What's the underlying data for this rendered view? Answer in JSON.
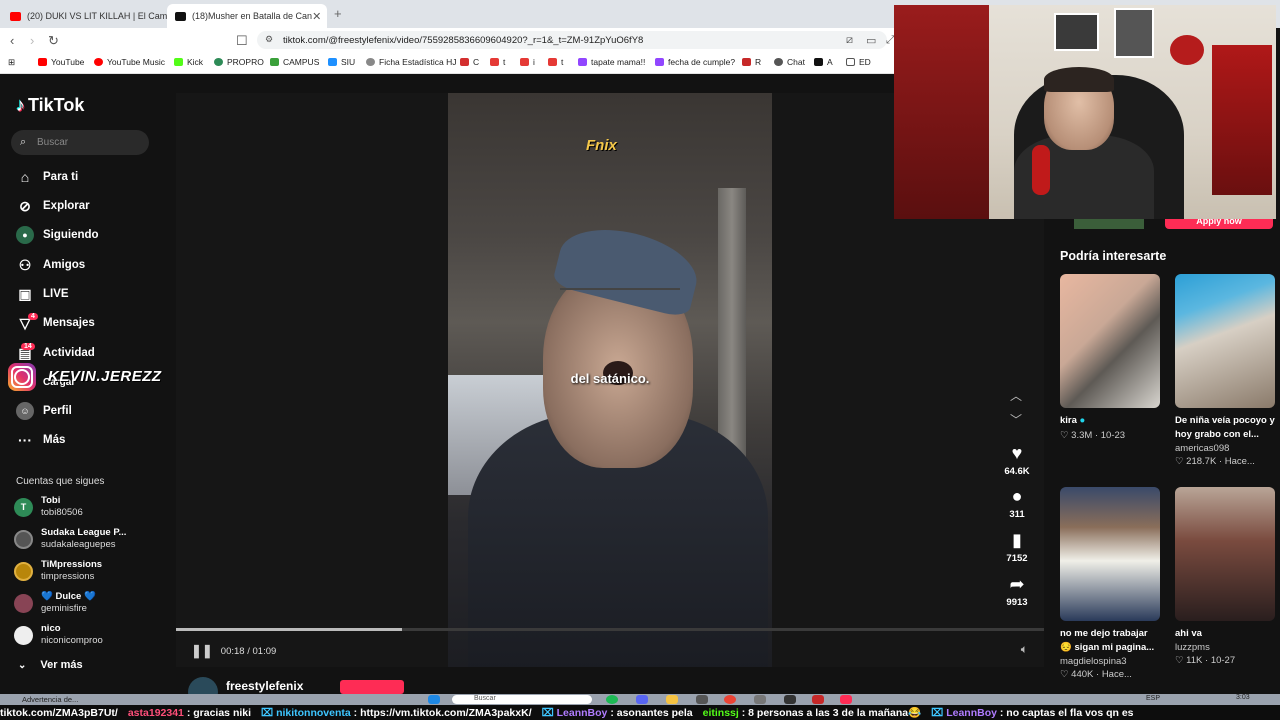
{
  "browser": {
    "tabs": [
      {
        "label": "(20) DUKI VS LIT KILLAH | El Campito",
        "icon": "youtube-icon",
        "color": "#ff0000"
      },
      {
        "label": "(18)Musher en Batalla de Can",
        "icon": "tiktok-icon",
        "color": "#111111"
      }
    ],
    "url": "tiktok.com/@freestylefenix/video/7559285836609604920?_r=1&_t=ZM-91ZpYuO6fY8",
    "bookmarks": [
      {
        "label": "YouTube",
        "color": "#ff0000"
      },
      {
        "label": "YouTube Music",
        "color": "#ff0000"
      },
      {
        "label": "Kick",
        "color": "#53fc18"
      },
      {
        "label": "PROPRO",
        "color": "#2e8b57"
      },
      {
        "label": "CAMPUS",
        "color": "#3aa03a"
      },
      {
        "label": "SIU",
        "color": "#1e90ff"
      },
      {
        "label": "Ficha Estadística HJ",
        "color": "#888888"
      },
      {
        "label": "C",
        "color": "#d32f2f"
      },
      {
        "label": "t",
        "color": "#e53935"
      },
      {
        "label": "i",
        "color": "#e53935"
      },
      {
        "label": "t",
        "color": "#e53935"
      },
      {
        "label": "tapate mama!!",
        "color": "#9146ff"
      },
      {
        "label": "fecha de cumple?",
        "color": "#9146ff"
      },
      {
        "label": "R",
        "color": "#c62828"
      },
      {
        "label": "Chat",
        "color": "#555555"
      },
      {
        "label": "A",
        "color": "#111111"
      },
      {
        "label": "ED",
        "color": "#555555"
      }
    ]
  },
  "sidebar": {
    "logo": "TikTok",
    "search_placeholder": "Buscar",
    "nav": [
      {
        "label": "Para ti",
        "icon": "home-icon"
      },
      {
        "label": "Explorar",
        "icon": "compass-icon"
      },
      {
        "label": "Siguiendo",
        "icon": "following-icon"
      },
      {
        "label": "Amigos",
        "icon": "friends-icon"
      },
      {
        "label": "LIVE",
        "icon": "live-icon"
      },
      {
        "label": "Mensajes",
        "icon": "messages-icon",
        "badge": "4"
      },
      {
        "label": "Actividad",
        "icon": "activity-icon",
        "badge": "14"
      },
      {
        "label": "Cargar",
        "icon": "upload-icon"
      },
      {
        "label": "Perfil",
        "icon": "profile-icon"
      },
      {
        "label": "Más",
        "icon": "more-icon"
      }
    ],
    "following_title": "Cuentas que sigues",
    "following": [
      {
        "name": "Tobi",
        "handle": "tobi80506",
        "initial": "T",
        "color": "#2e8b57"
      },
      {
        "name": "Sudaka League P...",
        "handle": "sudakaleaguepes",
        "initial": "",
        "color": "#555555"
      },
      {
        "name": "TiMpressions",
        "handle": "timpressions",
        "initial": "",
        "color": "#b8860b"
      },
      {
        "name": "💙 Dulce 💙",
        "handle": "geminisfire",
        "initial": "",
        "color": "#884455"
      },
      {
        "name": "nico",
        "handle": "niconicomproo",
        "initial": "",
        "color": "#eeeeee"
      }
    ],
    "see_more": "Ver más"
  },
  "overlay": {
    "instagram_handle": "KEVIN.JEREZZ"
  },
  "video": {
    "watermark": "Fnix",
    "subtitle": "del satánico.",
    "current_time": "00:18",
    "duration": "01:09",
    "progress": 0.26,
    "likes": "64.6K",
    "comments": "311",
    "saves": "7152",
    "shares": "9913",
    "author": "freestylefenix"
  },
  "recommendations": {
    "apply_label": "Apply now",
    "title": "Podría interesarte",
    "cards": [
      {
        "title": "kira",
        "user": "",
        "likes": "3.3M",
        "date": "10-23",
        "color": "#c9a896",
        "verified": true
      },
      {
        "title": "De niña veía pocoyo y hoy grabo con el...",
        "user": "americas098",
        "likes": "218.7K",
        "date": "Hace...",
        "color": "#d7cfc4"
      },
      {
        "title": "no me dejo trabajar 😔 sigan mi pagina...",
        "user": "magdielospina3",
        "likes": "440K",
        "date": "Hace...",
        "color": "#8a6e5a"
      },
      {
        "title": "ahi va",
        "user": "luzzpms",
        "likes": "11K",
        "date": "10-27",
        "color": "#7a4b3f"
      }
    ]
  },
  "taskbar": {
    "notification": "Advertencia de...",
    "search_placeholder": "Buscar",
    "lang": "ESP",
    "time": "3:03"
  },
  "chat_ticker": [
    {
      "user": "",
      "message": "tiktok.com/ZMA3pB7Ut/",
      "color": "#ffffff"
    },
    {
      "user": "asta192341",
      "message": "gracias niki",
      "color": "#ff4f7a"
    },
    {
      "user": "nikitonnoventa",
      "message": "https://vm.tiktok.com/ZMA3pakxK/",
      "color": "#3ec6ff"
    },
    {
      "user": "LeannBoy",
      "message": "asonantes pela",
      "color": "#b07cff"
    },
    {
      "user": "eitinssj",
      "message": "8 personas a las 3 de la mañana😂",
      "color": "#53fc18"
    },
    {
      "user": "LeannBoy",
      "message": "no captas el fla vos  qn es",
      "color": "#b07cff"
    }
  ]
}
